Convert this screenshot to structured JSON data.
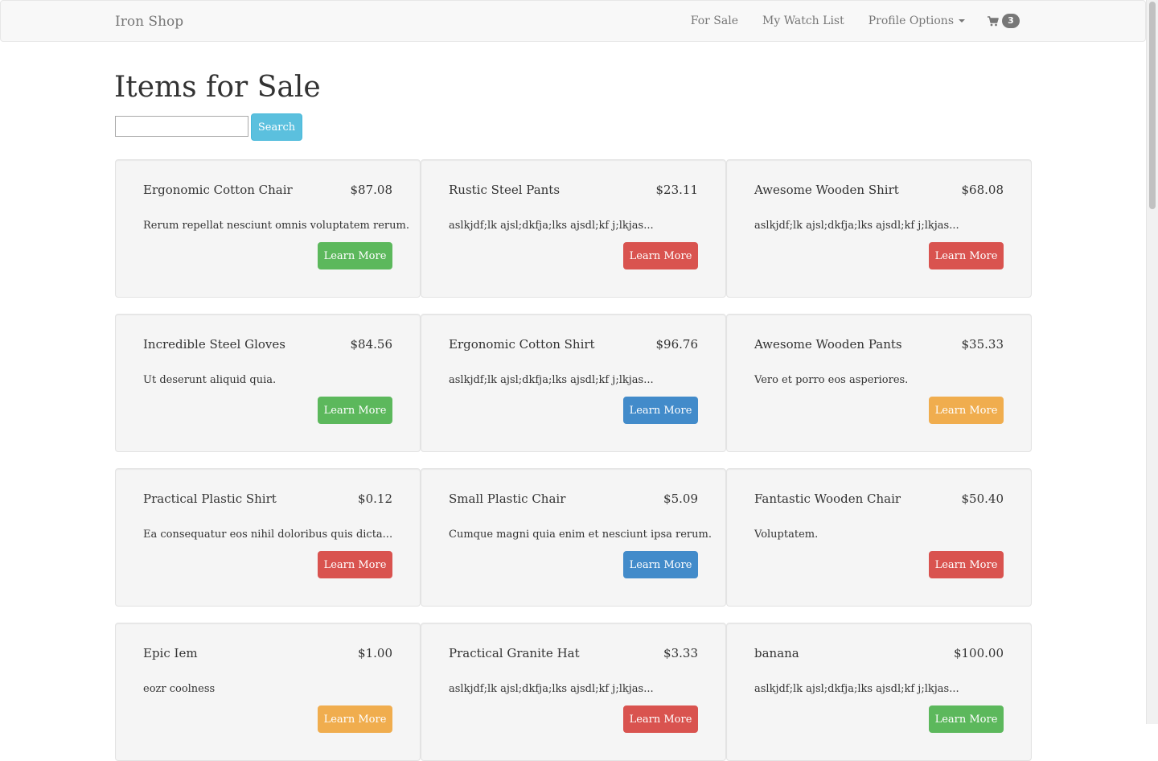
{
  "navbar": {
    "brand": "Iron Shop",
    "links": [
      "For Sale",
      "My Watch List",
      "Profile Options"
    ],
    "cart_icon": "shopping-cart-icon",
    "cart_count": "3"
  },
  "page": {
    "title": "Items for Sale",
    "search_value": "",
    "search_button": "Search"
  },
  "colors": {
    "success": "#5cb85c",
    "danger": "#d9534f",
    "primary": "#428bca",
    "warning": "#f0ad4e",
    "info": "#5bc0de"
  },
  "items": [
    {
      "name": "Ergonomic Cotton Chair",
      "price": "$87.08",
      "description": "Rerum repellat nesciunt omnis voluptatem rerum.",
      "button": "Learn More",
      "style": "success"
    },
    {
      "name": "Rustic Steel Pants",
      "price": "$23.11",
      "description": "aslkjdf;lk ajsl;dkfja;lks ajsdl;kf j;lkjas...",
      "button": "Learn More",
      "style": "danger"
    },
    {
      "name": "Awesome Wooden Shirt",
      "price": "$68.08",
      "description": "aslkjdf;lk ajsl;dkfja;lks ajsdl;kf j;lkjas...",
      "button": "Learn More",
      "style": "danger"
    },
    {
      "name": "Incredible Steel Gloves",
      "price": "$84.56",
      "description": "Ut deserunt aliquid quia.",
      "button": "Learn More",
      "style": "success"
    },
    {
      "name": "Ergonomic Cotton Shirt",
      "price": "$96.76",
      "description": "aslkjdf;lk ajsl;dkfja;lks ajsdl;kf j;lkjas...",
      "button": "Learn More",
      "style": "primary"
    },
    {
      "name": "Awesome Wooden Pants",
      "price": "$35.33",
      "description": "Vero et porro eos asperiores.",
      "button": "Learn More",
      "style": "warning"
    },
    {
      "name": "Practical Plastic Shirt",
      "price": "$0.12",
      "description": "Ea consequatur eos nihil doloribus quis dicta...",
      "button": "Learn More",
      "style": "danger"
    },
    {
      "name": "Small Plastic Chair",
      "price": "$5.09",
      "description": "Cumque magni quia enim et nesciunt ipsa rerum.",
      "button": "Learn More",
      "style": "primary"
    },
    {
      "name": "Fantastic Wooden Chair",
      "price": "$50.40",
      "description": "Voluptatem.",
      "button": "Learn More",
      "style": "danger"
    },
    {
      "name": "Epic Iem",
      "price": "$1.00",
      "description": "eozr coolness",
      "button": "Learn More",
      "style": "warning"
    },
    {
      "name": "Practical Granite Hat",
      "price": "$3.33",
      "description": "aslkjdf;lk ajsl;dkfja;lks ajsdl;kf j;lkjas...",
      "button": "Learn More",
      "style": "danger"
    },
    {
      "name": "banana",
      "price": "$100.00",
      "description": "aslkjdf;lk ajsl;dkfja;lks ajsdl;kf j;lkjas...",
      "button": "Learn More",
      "style": "success"
    }
  ]
}
